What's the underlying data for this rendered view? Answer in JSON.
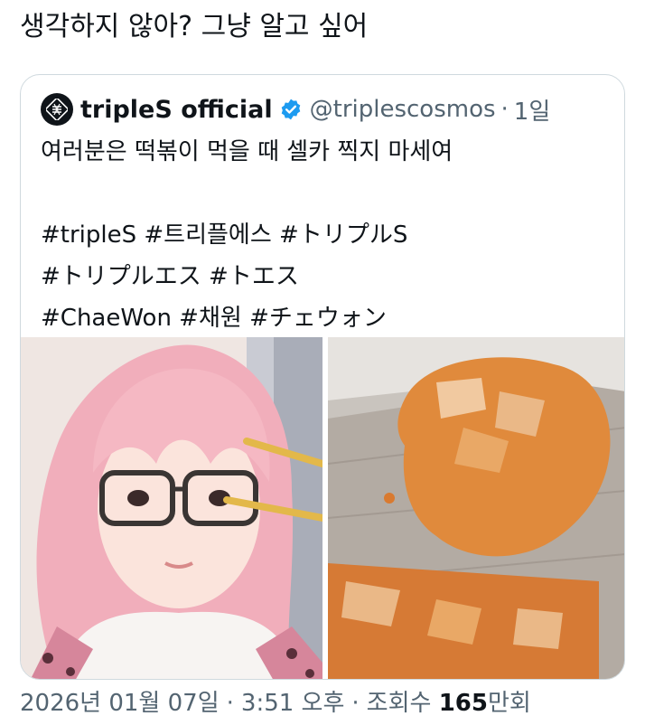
{
  "post": {
    "text": "생각하지 않아? 그냥 알고 싶어"
  },
  "quote": {
    "display_name": "tripleS official",
    "handle": "@triplescosmos",
    "separator": "·",
    "time": "1일",
    "body_lines": [
      "여러분은 떡볶이 먹을 때 셀카 찍지 마세여",
      "",
      "#tripleS #트리플에스 #トリプルS",
      "#トリプルエス #トエス",
      "#ChaeWon #채원 #チェウォン"
    ]
  },
  "meta": {
    "date": "2026년 01월 07일",
    "time": "3:51 오후",
    "views_prefix": "조회수",
    "views_number": "165",
    "views_suffix": "만회",
    "separator": "·"
  },
  "icons": {
    "avatar": "triples-logo-icon",
    "verified": "verified-badge-icon"
  },
  "colors": {
    "text_primary": "#0f1419",
    "text_secondary": "#536471",
    "border": "#cfd9de",
    "verified": "#1d9bf0",
    "sauce": "#e08a3c",
    "hair": "#f1aebb"
  }
}
